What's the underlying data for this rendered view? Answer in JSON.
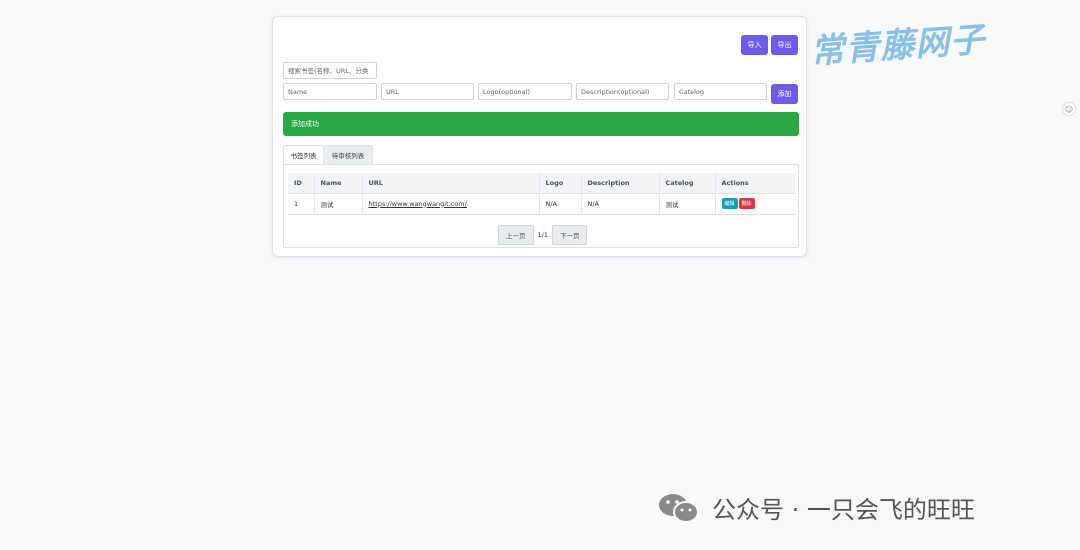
{
  "toolbar": {
    "import_label": "导入",
    "export_label": "导出",
    "add_label": "添加"
  },
  "search": {
    "placeholder": "搜索书签(名称、URL、分类"
  },
  "form": {
    "name_placeholder": "Name",
    "url_placeholder": "URL",
    "logo_placeholder": "Logo(optional)",
    "description_placeholder": "Description(optional)",
    "catelog_placeholder": "Catelog"
  },
  "alert": {
    "message": "添加成功",
    "color": "#28a745"
  },
  "tabs": [
    {
      "label": "书签列表",
      "active": true
    },
    {
      "label": "待审核列表",
      "active": false
    }
  ],
  "table": {
    "headers": [
      "ID",
      "Name",
      "URL",
      "Logo",
      "Description",
      "Catelog",
      "Actions"
    ],
    "rows": [
      {
        "id": "1",
        "name": "测试",
        "url": "https://www.wangwangit.com/",
        "logo": "N/A",
        "description": "N/A",
        "catelog": "测试",
        "edit_label": "编辑",
        "delete_label": "删除"
      }
    ]
  },
  "pagination": {
    "prev_label": "上一页",
    "info": "1/1",
    "next_label": "下一页"
  },
  "watermark": {
    "text": "常青藤网子"
  },
  "footer": {
    "text": "公众号 · 一只会飞的旺旺"
  },
  "colors": {
    "accent": "#6c5ce7",
    "success": "#28a745",
    "info": "#17a2b8",
    "danger": "#dc3545"
  },
  "icons": {
    "side": "smiley-icon",
    "footer": "wechat-icon"
  }
}
